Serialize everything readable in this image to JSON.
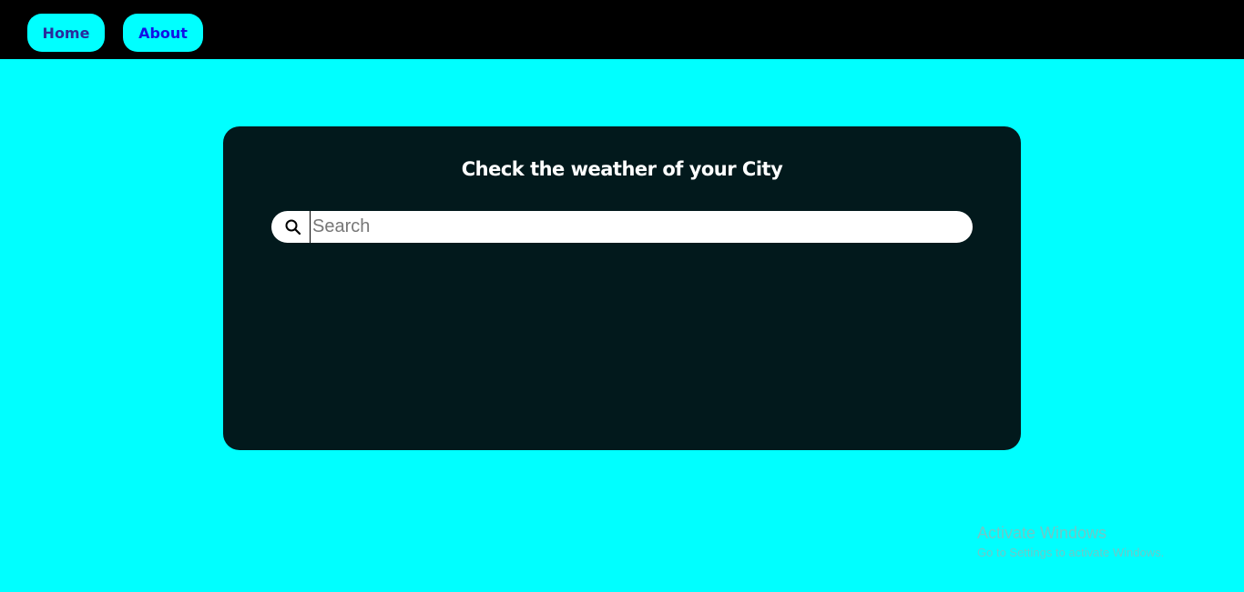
{
  "nav": {
    "home_label": "Home",
    "about_label": "About"
  },
  "card": {
    "title": "Check the weather of your City",
    "search": {
      "placeholder": "Search",
      "value": "",
      "icon": "search-icon"
    }
  },
  "watermark": {
    "title": "Activate Windows",
    "subtitle": "Go to Settings to activate Windows."
  },
  "colors": {
    "background": "#00ffff",
    "navbar": "#000000",
    "card": "#02191c",
    "nav_button": "#00ffff"
  }
}
